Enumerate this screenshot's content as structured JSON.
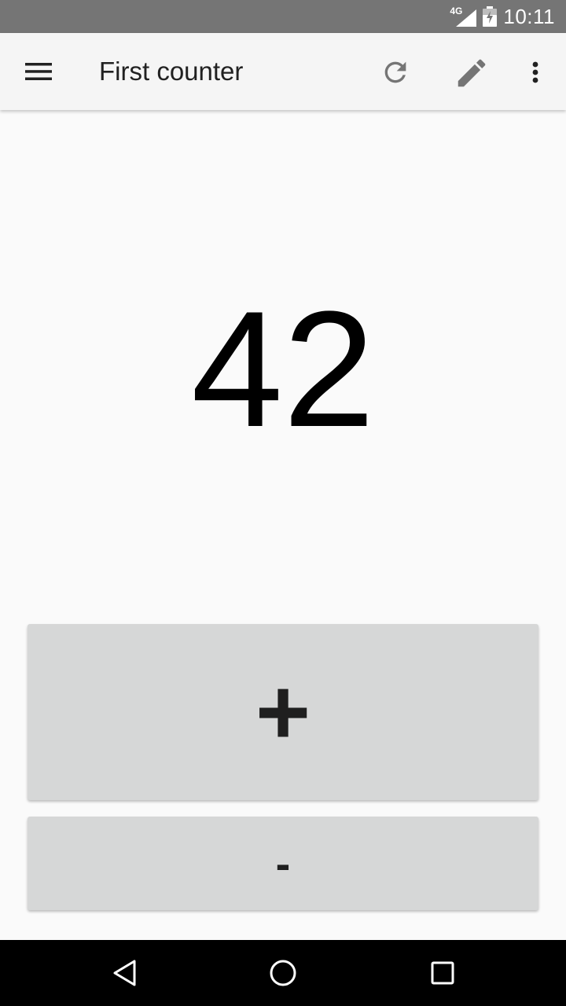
{
  "status_bar": {
    "network": "4G",
    "time": "10:11"
  },
  "app_bar": {
    "title": "First counter",
    "icons": [
      "menu-icon",
      "refresh-icon",
      "edit-icon",
      "more-vert-icon"
    ]
  },
  "counter": {
    "value": "42"
  },
  "buttons": {
    "increment_label": "+",
    "decrement_label": "-"
  },
  "nav_bar": {
    "icons": [
      "back-icon",
      "home-icon",
      "recents-icon"
    ]
  },
  "colors": {
    "status_bar": "#757575",
    "app_bar": "#f5f5f5",
    "background": "#fafafa",
    "button": "#d6d7d7",
    "nav_bar": "#000000"
  }
}
